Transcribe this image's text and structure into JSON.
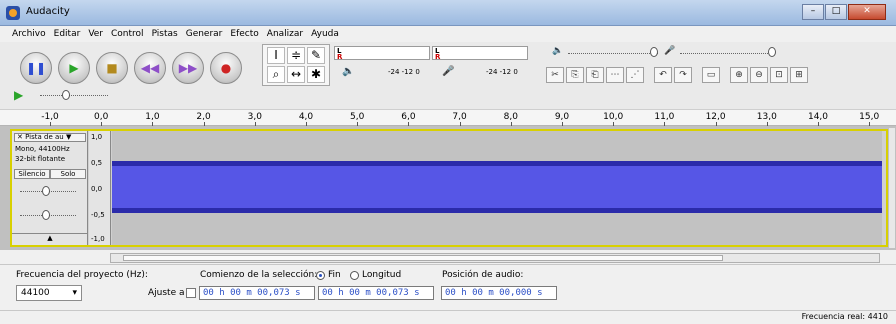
{
  "window": {
    "title": "Audacity",
    "min": "–",
    "max": "□",
    "close": "✕"
  },
  "menu": [
    "Archivo",
    "Editar",
    "Ver",
    "Control",
    "Pistas",
    "Generar",
    "Efecto",
    "Analizar",
    "Ayuda"
  ],
  "transport": {
    "pause": "❚❚",
    "play": "▶",
    "stop": "■",
    "skip_start": "◀◀",
    "skip_end": "▶▶",
    "record": "●"
  },
  "tools": {
    "select": "I",
    "envelope": "≑",
    "draw": "✎",
    "zoom": "⌕",
    "timeshift": "↔",
    "multi": "✱"
  },
  "meter": {
    "left": "L",
    "right": "R",
    "scale_a": "-24  -12  0",
    "scale_b": "-24  -12  0"
  },
  "edit_tools": [
    "✂",
    "⎘",
    "⎗",
    "⋯",
    "⋰",
    "↶",
    "↷",
    "▭",
    "⊕",
    "⊖",
    "⊡",
    "⊞"
  ],
  "ruler": [
    "-1,0",
    "0,0",
    "1,0",
    "2,0",
    "3,0",
    "4,0",
    "5,0",
    "6,0",
    "7,0",
    "8,0",
    "9,0",
    "10,0",
    "11,0",
    "12,0",
    "13,0",
    "14,0",
    "15,0"
  ],
  "track": {
    "name": "Pista de au",
    "format": "Mono, 44100Hz",
    "bits": "32-bit flotante",
    "mute": "Silencio",
    "solo": "Solo",
    "scale": [
      "1,0",
      "0,5",
      "0,0",
      "-0,5",
      "-1,0"
    ],
    "expand": "▲"
  },
  "selection": {
    "rate_label": "Frecuencia del proyecto (Hz):",
    "rate_value": "44100",
    "snap_label": "Ajuste a",
    "start_label": "Comienzo de la selección:",
    "end_option": "Fin",
    "length_option": "Longitud",
    "start_value": "00 h 00 m 00,073 s",
    "end_value": "00 h 00 m 00,073 s",
    "audio_pos_label": "Posición de audio:",
    "audio_pos_value": "00 h 00 m 00,000 s"
  },
  "status": {
    "actual_rate": "Frecuencia real: 4410"
  },
  "colors": {
    "waveform": "#5656e6",
    "waveform_edge": "#2b2baa",
    "track_border": "#d8d000"
  }
}
